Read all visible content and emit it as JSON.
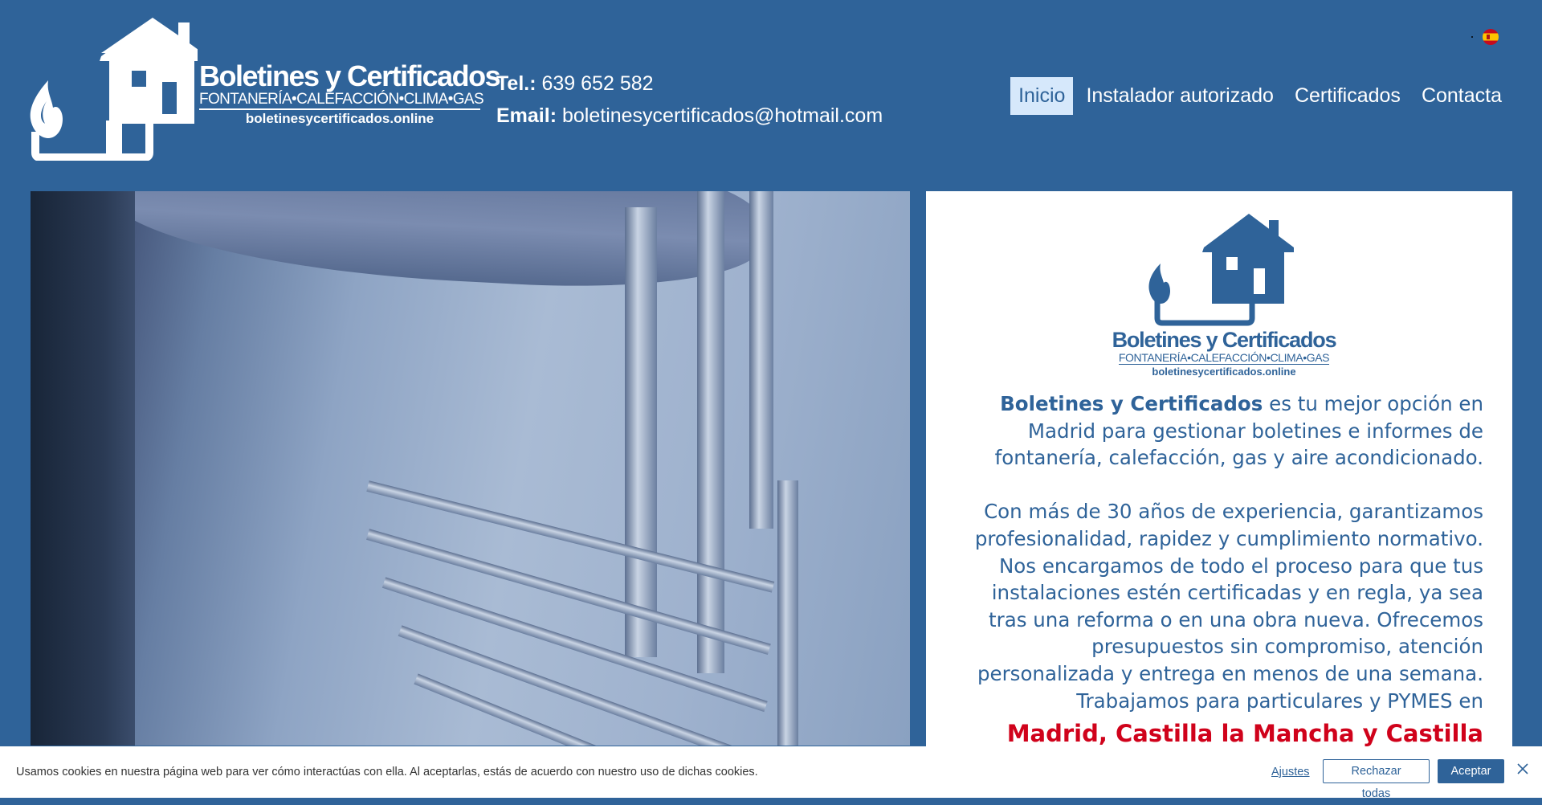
{
  "header": {
    "logo": {
      "title": "Boletines y Certificados",
      "subtitle": "FONTANERÍA•CALEFACCIÓN•CLIMA•GAS",
      "url": "boletinesycertificados.online"
    },
    "contact": {
      "tel_label": "Tel.:",
      "tel_value": "639 652 582",
      "email_label": "Email:",
      "email_value": "boletinesycertificados@hotmail.com"
    },
    "nav": [
      {
        "label": "Inicio",
        "active": true
      },
      {
        "label": "Instalador autorizado",
        "active": false
      },
      {
        "label": "Certificados",
        "active": false
      },
      {
        "label": "Contacta",
        "active": false
      }
    ],
    "language_icon": "spain-flag-icon"
  },
  "hero": {
    "image": "plumber-fitting-pipes-photo"
  },
  "panel": {
    "logo": {
      "title": "Boletines y Certificados",
      "subtitle": "FONTANERÍA•CALEFACCIÓN•CLIMA•GAS",
      "url": "boletinesycertificados.online"
    },
    "intro_bold": "Boletines y Certificados",
    "intro_rest": " es tu mejor opción en Madrid para gestionar boletines e informes de fontanería, calefacción, gas y aire acondicionado.",
    "body": "Con más de 30 años de experiencia, garantizamos profesionalidad, rapidez y cumplimiento normativo. Nos encargamos de todo el proceso para que tus instalaciones estén certificadas y en regla, ya sea tras una reforma o en una obra nueva. Ofrecemos presupuestos sin compromiso, atención personalizada y entrega en menos de una semana. Trabajamos para particulares y PYMES en",
    "region": "Madrid, Castilla la Mancha y Castilla León"
  },
  "cookie_bar": {
    "text": "Usamos cookies en nuestra página web para ver cómo interactúas con ella. Al aceptarlas, estás de acuerdo con nuestro uso de dichas cookies.",
    "settings_label": "Ajustes",
    "reject_label": "Rechazar todas",
    "accept_label": "Aceptar"
  },
  "colors": {
    "brand_blue": "#2f6399",
    "nav_active_bg": "#d6e8fb",
    "region_red": "#d0021b",
    "panel_bg": "#ffffff"
  }
}
